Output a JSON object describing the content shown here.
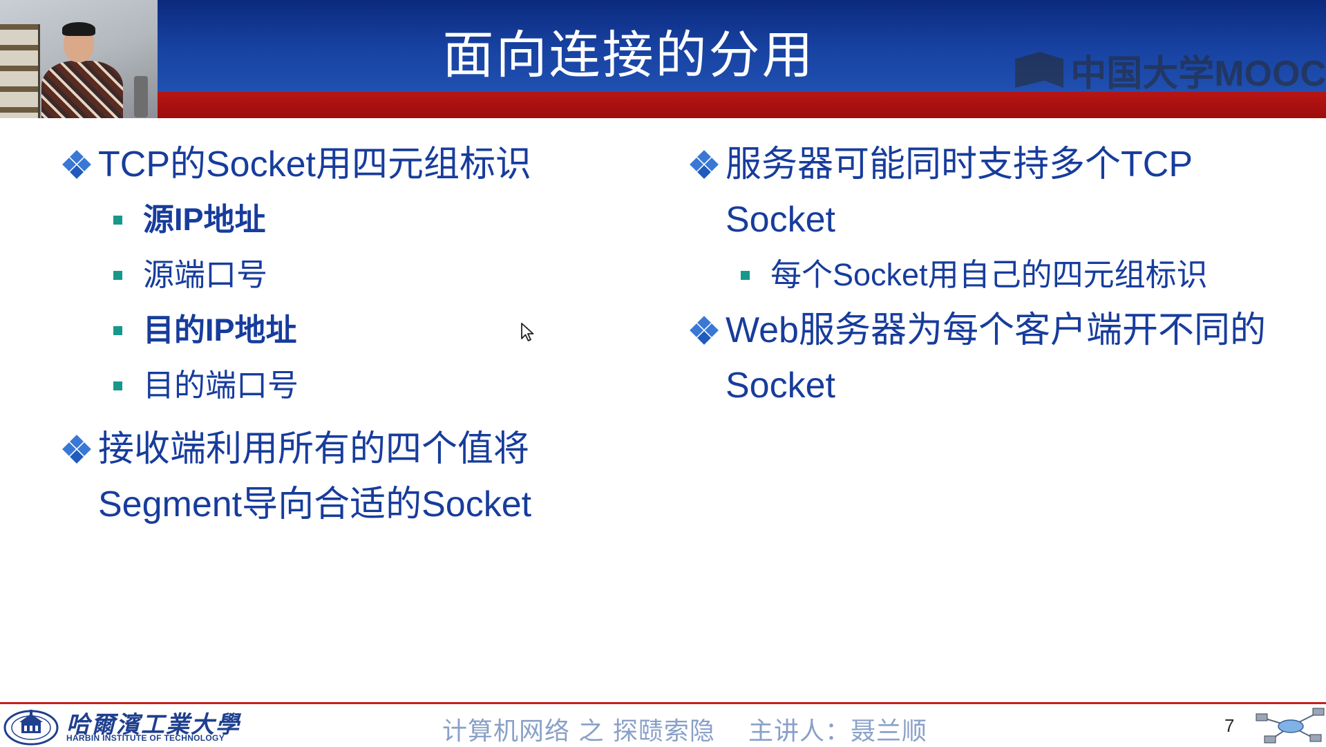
{
  "slide": {
    "title": "面向连接的分用",
    "watermark": "中国大学MOOC"
  },
  "left_column": {
    "items": [
      {
        "level": 1,
        "text": "TCP的Socket用四元组标识"
      },
      {
        "level": 2,
        "text": "源IP地址"
      },
      {
        "level": 2,
        "text": "源端口号"
      },
      {
        "level": 2,
        "text": "目的IP地址"
      },
      {
        "level": 2,
        "text": "目的端口号"
      },
      {
        "level": 1,
        "text": "接收端利用所有的四个值将Segment导向合适的Socket"
      }
    ]
  },
  "right_column": {
    "items": [
      {
        "level": 1,
        "text": "服务器可能同时支持多个TCP Socket"
      },
      {
        "level": 2,
        "text": "每个Socket用自己的四元组标识"
      },
      {
        "level": 1,
        "text": "Web服务器为每个客户端开不同的Socket"
      }
    ]
  },
  "footer": {
    "university_cn": "哈爾濱工業大學",
    "university_en": "HARBIN INSTITUTE OF TECHNOLOGY",
    "course": "计算机网络 之 探赜索隐",
    "lecturer": "主讲人：聂兰顺",
    "page_number": "7"
  },
  "colors": {
    "header_blue": "#1843a3",
    "header_red": "#a50f0f",
    "text_blue": "#173c9c",
    "diamond_blue": "#3a78d6",
    "subbullet_teal": "#17988a",
    "footer_text": "#8aa0c8"
  }
}
